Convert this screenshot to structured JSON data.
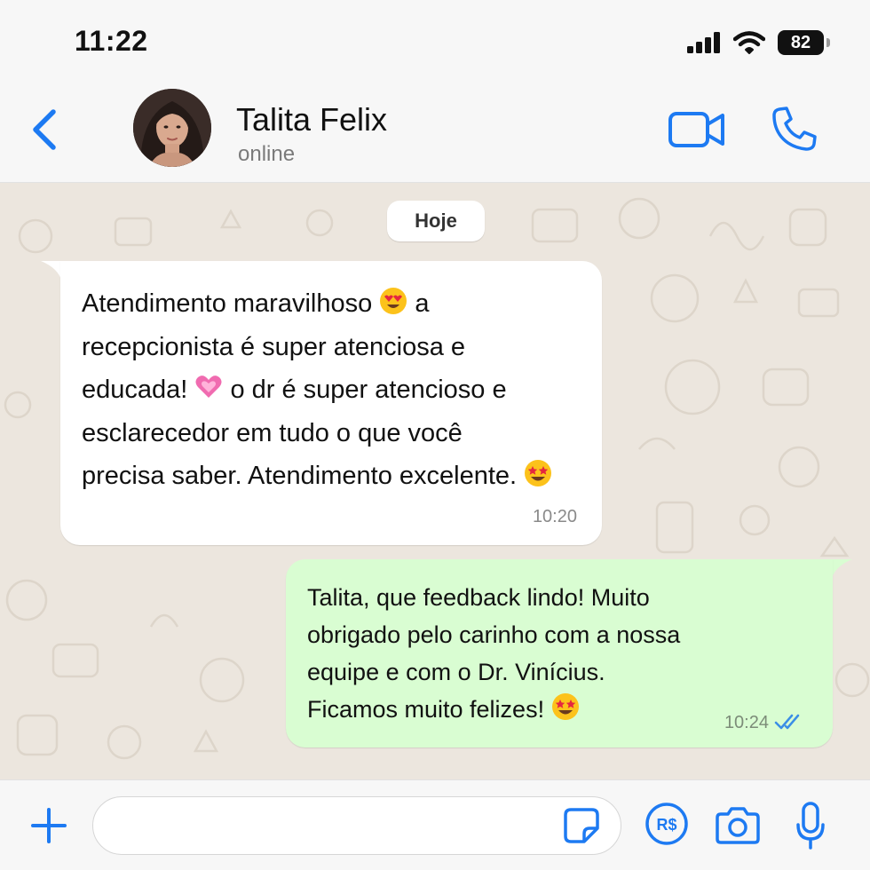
{
  "status_bar": {
    "time": "11:22",
    "battery": "82"
  },
  "header": {
    "contact_name": "Talita Felix",
    "contact_status": "online"
  },
  "chat": {
    "date_label": "Hoje",
    "messages": [
      {
        "direction": "incoming",
        "lines": [
          "Atendimento maravilhoso",
          "a",
          "recepcionista é super atenciosa e",
          "educada!",
          "o dr é super atencioso e",
          "esclarecedor em tudo o que você",
          "precisa saber. Atendimento excelente."
        ],
        "emojis": [
          "heart-eyes",
          "pink-heart",
          "star-struck"
        ],
        "time": "10:20"
      },
      {
        "direction": "outgoing",
        "lines": [
          "Talita, que feedback lindo! Muito",
          "obrigado pelo carinho com a nossa",
          "equipe e com o Dr. Vinícius.",
          "Ficamos muito felizes!"
        ],
        "emojis": [
          "star-struck"
        ],
        "time": "10:24",
        "read_status": "read"
      }
    ]
  },
  "input_bar": {
    "placeholder": ""
  },
  "icons": [
    "back-chevron-icon",
    "video-camera-icon",
    "phone-icon",
    "plus-icon",
    "sticker-icon",
    "pay-icon",
    "camera-icon",
    "microphone-icon",
    "double-check-icon",
    "signal-icon",
    "wifi-icon"
  ],
  "colors": {
    "accent": "#1d7af2",
    "incoming_bubble": "#ffffff",
    "outgoing_bubble": "#d9fdd2",
    "chat_background": "#ece6de",
    "read_ticks": "#3a8ee6"
  }
}
